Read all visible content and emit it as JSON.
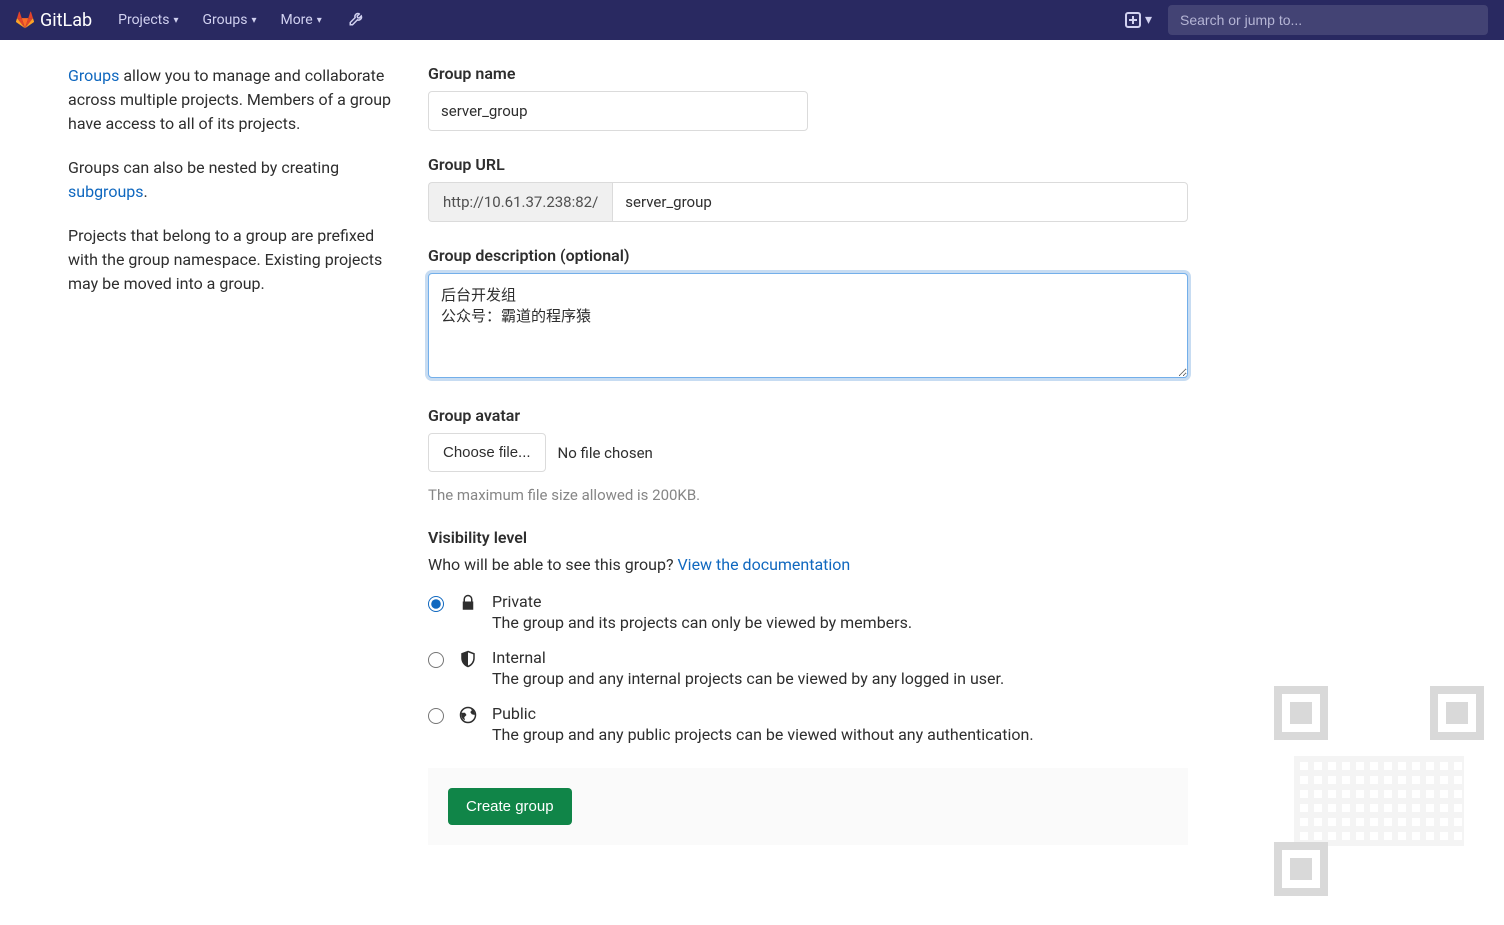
{
  "navbar": {
    "brand": "GitLab",
    "items": [
      "Projects",
      "Groups",
      "More"
    ],
    "search_placeholder": "Search or jump to..."
  },
  "sidebar": {
    "p1_link": "Groups",
    "p1_rest": " allow you to manage and collaborate across multiple projects. Members of a group have access to all of its projects.",
    "p2_pre": "Groups can also be nested by creating ",
    "p2_link": "subgroups",
    "p2_post": ".",
    "p3": "Projects that belong to a group are prefixed with the group namespace. Existing projects may be moved into a group."
  },
  "form": {
    "group_name": {
      "label": "Group name",
      "value": "server_group"
    },
    "group_url": {
      "label": "Group URL",
      "base": "http://10.61.37.238:82/",
      "value": "server_group"
    },
    "group_desc": {
      "label": "Group description (optional)",
      "value": "后台开发组\n公众号：霸道的程序猿"
    },
    "group_avatar": {
      "label": "Group avatar",
      "choose_btn": "Choose file...",
      "status": "No file chosen",
      "hint": "The maximum file size allowed is 200KB."
    },
    "visibility": {
      "label": "Visibility level",
      "intro_pre": "Who will be able to see this group? ",
      "intro_link": "View the documentation",
      "options": [
        {
          "title": "Private",
          "desc": "The group and its projects can only be viewed by members.",
          "checked": true
        },
        {
          "title": "Internal",
          "desc": "The group and any internal projects can be viewed by any logged in user.",
          "checked": false
        },
        {
          "title": "Public",
          "desc": "The group and any public projects can be viewed without any authentication.",
          "checked": false
        }
      ]
    },
    "submit": "Create group"
  }
}
